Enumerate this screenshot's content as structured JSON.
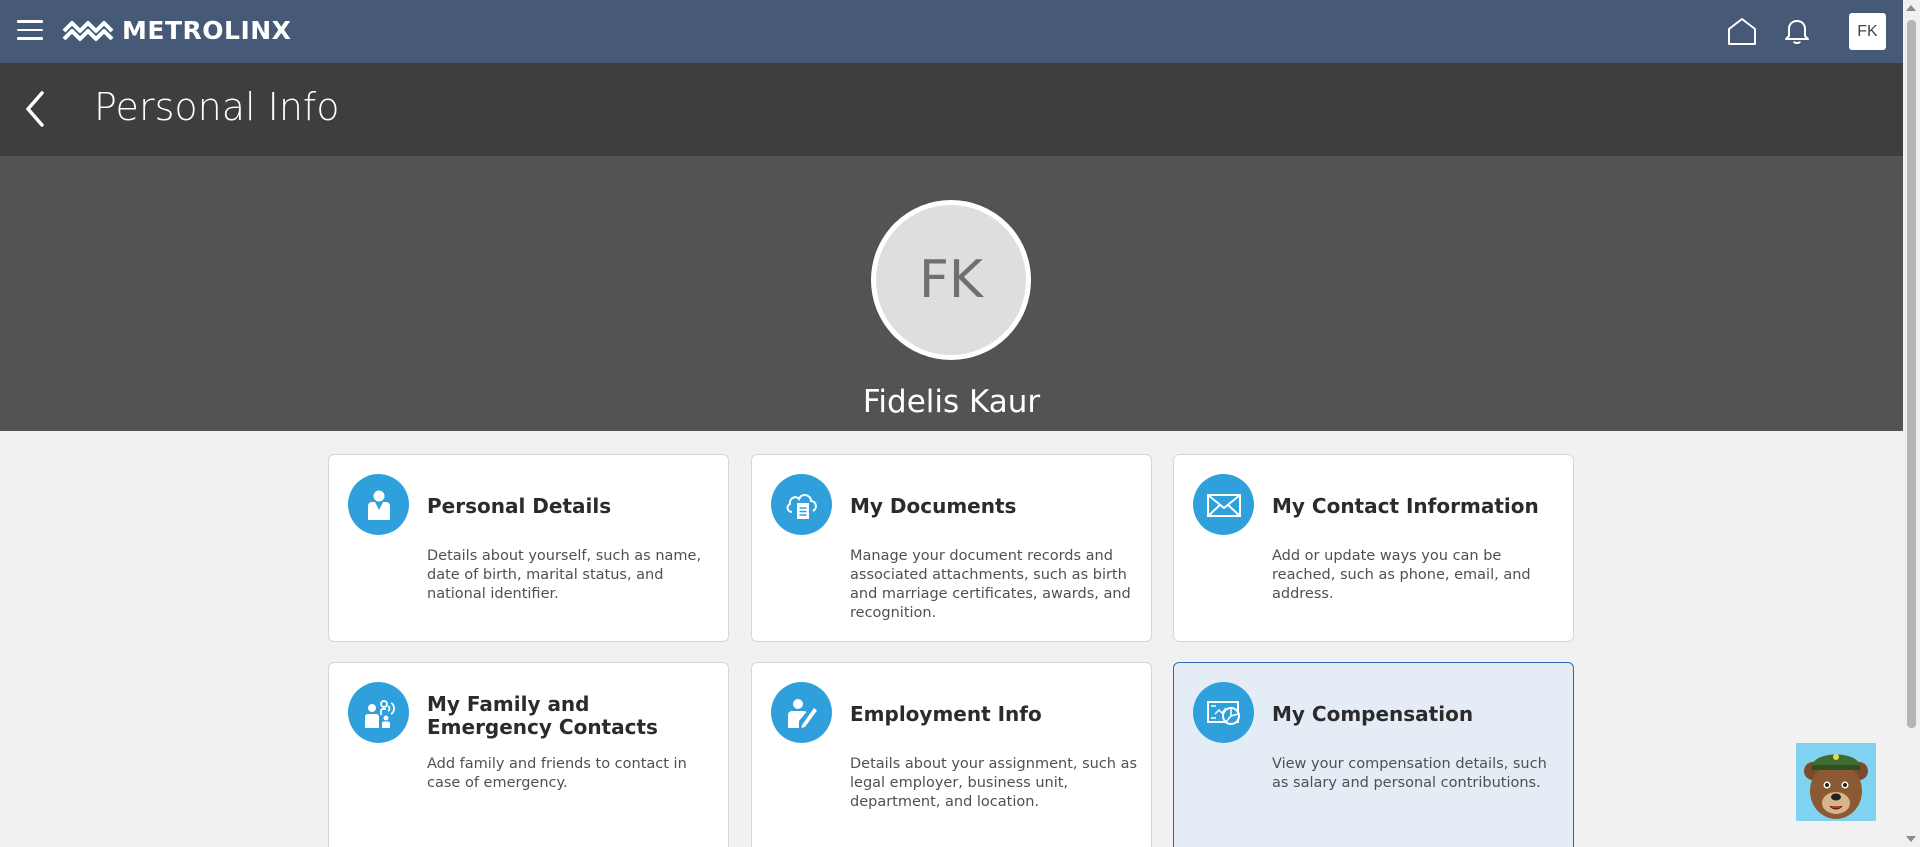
{
  "header": {
    "brand": "METROLINX",
    "user_initials": "FK"
  },
  "page": {
    "title": "Personal Info"
  },
  "profile": {
    "initials": "FK",
    "name": "Fidelis Kaur"
  },
  "cards": [
    {
      "title": "Personal Details",
      "description": "Details about yourself, such as name, date of birth, marital status, and national identifier.",
      "icon": "person-icon"
    },
    {
      "title": "My Documents",
      "description": "Manage your document records and associated attachments, such as birth and marriage certificates, awards, and recognition.",
      "icon": "cloud-document-icon"
    },
    {
      "title": "My Contact Information",
      "description": "Add or update ways you can be reached, such as phone, email, and address.",
      "icon": "envelope-icon"
    },
    {
      "title": "My Family and Emergency Contacts",
      "description": "Add family and friends to contact in case of emergency.",
      "icon": "family-icon"
    },
    {
      "title": "Employment Info",
      "description": "Details about your assignment, such as legal employer, business unit, department, and location.",
      "icon": "person-pen-icon"
    },
    {
      "title": "My Compensation",
      "description": "View your compensation details, such as salary and personal contributions.",
      "icon": "compensation-icon"
    }
  ],
  "colors": {
    "topbar": "#465a78",
    "page_header": "#3e3e3e",
    "hero": "#535353",
    "icon_circle": "#2fa0db",
    "selected_card": "#e4ecf5"
  }
}
